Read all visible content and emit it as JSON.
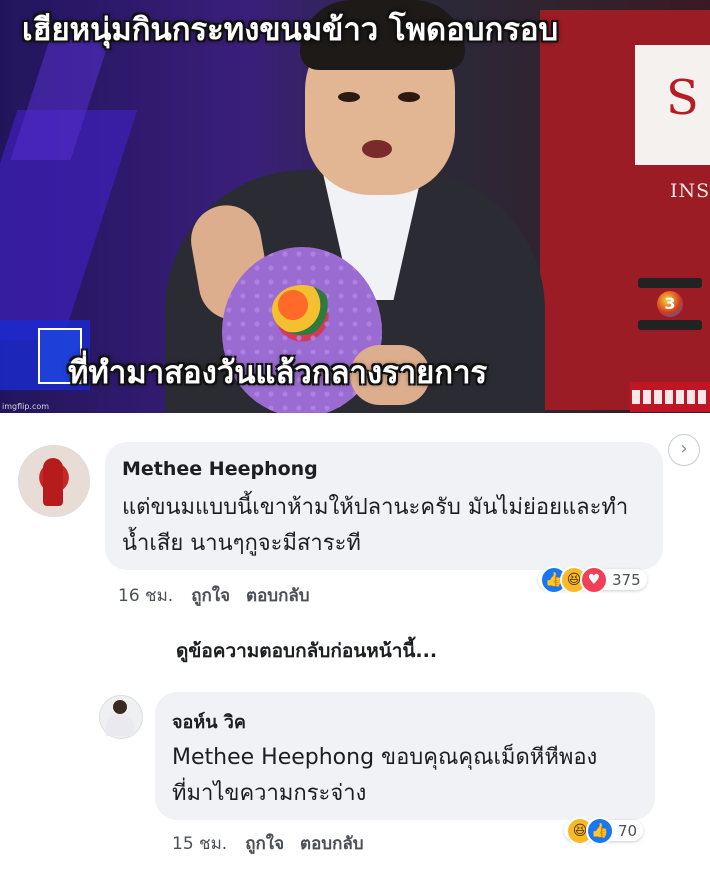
{
  "video": {
    "caption_top": "เฮียหนุ่มกินกระทงขนมข้าว โพดอบกรอบ",
    "caption_bottom": "ที่ทำมาสองวันแล้วกลางรายการ",
    "studio_sign_letter": "S",
    "studio_sign_text": "INS",
    "channel_number": "3",
    "watermark": "imgflip.com"
  },
  "comments": {
    "first": {
      "author": "Methee Heephong",
      "text": "แต่ขนมแบบนี้เขาห้ามให้ปลานะครับ มันไม่ย่อยและทำน้ำเสีย นานๆกูจะมีสาระที",
      "time": "16 ชม.",
      "like_label": "ถูกใจ",
      "reply_label": "ตอบกลับ",
      "reactions": [
        "like-icon",
        "haha-icon",
        "love-icon"
      ],
      "reaction_count": "375"
    },
    "view_previous": "ดูข้อความตอบกลับก่อนหน้านี้...",
    "reply": {
      "author": "จอห์น วิค",
      "text": "Methee Heephong ขอบคุณคุณเม็ดหีหีพอง ที่มาไขความกระจ่าง",
      "time": "15 ชม.",
      "like_label": "ถูกใจ",
      "reply_label": "ตอบกลับ",
      "reactions": [
        "haha-icon",
        "like-icon"
      ],
      "reaction_count": "70"
    }
  },
  "colors": {
    "bubble": "#f0f2f5",
    "like_blue": "#1877f2",
    "love_red": "#f33e58",
    "haha_yellow": "#f7b928",
    "studio_red": "#9b1c24"
  }
}
